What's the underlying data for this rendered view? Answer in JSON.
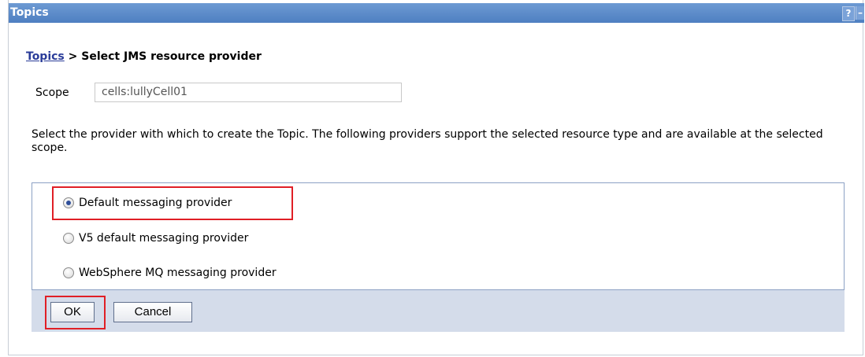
{
  "titlebar": {
    "title": "Topics",
    "help_label": "?",
    "minimize_label": "–"
  },
  "breadcrumb": {
    "link": "Topics",
    "separator": ">",
    "current": "Select JMS resource provider"
  },
  "scope": {
    "label": "Scope",
    "value": "cells:lullyCell01"
  },
  "description": "Select the provider with which to create the Topic. The following providers support the selected resource type and are available at the selected scope.",
  "providers": [
    {
      "label": "Default messaging provider",
      "selected": true
    },
    {
      "label": "V5 default messaging provider",
      "selected": false
    },
    {
      "label": "WebSphere MQ messaging provider",
      "selected": false
    }
  ],
  "buttons": {
    "ok": "OK",
    "cancel": "Cancel"
  },
  "colors": {
    "titlebar": "#5a88c8",
    "highlight": "#e01f26",
    "link": "#2a3c99",
    "button_bar": "#d4dcea"
  }
}
